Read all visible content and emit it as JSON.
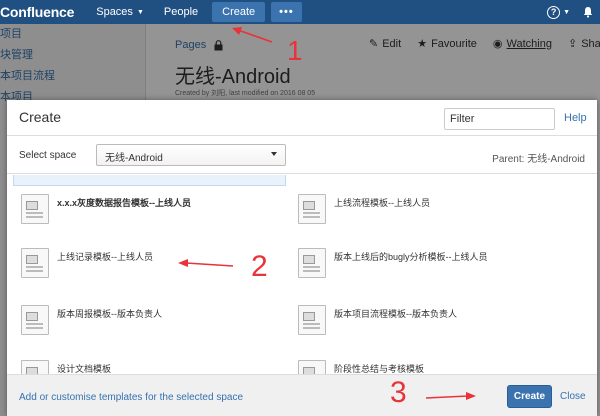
{
  "topnav": {
    "logo": "Confluence",
    "spaces": "Spaces",
    "people": "People",
    "create": "Create",
    "more": "•••",
    "help": "?",
    "bg_color": "#205081"
  },
  "sidebar": {
    "items": [
      "项目",
      "块管理",
      "本项目流程",
      "本项目"
    ]
  },
  "page": {
    "breadcrumb": "Pages",
    "actions": {
      "edit": "Edit",
      "favourite": "Favourite",
      "watching": "Watching",
      "share": "Sha"
    },
    "title": "无线-Android",
    "meta": "Created by 刘阳, last modified on 2016 08 05"
  },
  "dialog": {
    "title": "Create",
    "filter_placeholder": "Filter",
    "help": "Help",
    "select_space_label": "Select space",
    "selected_space": "无线-Android",
    "parent": "Parent: 无线-Android",
    "templates": [
      {
        "label": "x.x.x灰度数据报告模板--上线人员"
      },
      {
        "label": "上线流程模板--上线人员"
      },
      {
        "label": "上线记录模板--上线人员"
      },
      {
        "label": "版本上线后的bugly分析模板--上线人员"
      },
      {
        "label": "版本周报模板--版本负责人"
      },
      {
        "label": "版本项目流程模板--版本负责人"
      },
      {
        "label": "设计文档模板"
      },
      {
        "label": "阶段性总结与考核模板"
      }
    ],
    "footer": {
      "customise": "Add or customise templates for the selected space",
      "create": "Create",
      "close": "Close"
    }
  },
  "annotations": {
    "step1": "1",
    "step2": "2",
    "step3": "3",
    "color": "#e8333a"
  }
}
